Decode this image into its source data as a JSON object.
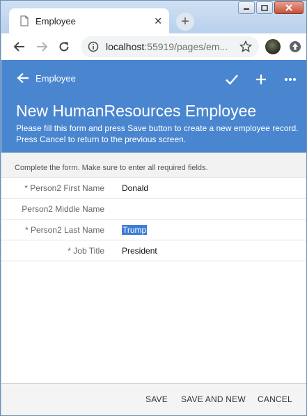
{
  "browser": {
    "tab_title": "Employee",
    "tab_close": "✕",
    "new_tab": "+",
    "url_host": "localhost",
    "url_rest": ":55919/pages/em..."
  },
  "header": {
    "back_label": "Employee",
    "title": "New HumanResources Employee",
    "subtitle": "Please fill this form and press Save button to create a new employee record. Press Cancel to return to the previous screen."
  },
  "form": {
    "instructions": "Complete the form. Make sure to enter all required fields.",
    "fields": [
      {
        "label": "* Person2 First Name",
        "value": "Donald"
      },
      {
        "label": "Person2 Middle Name",
        "value": ""
      },
      {
        "label": "* Person2 Last Name",
        "value": "Trump"
      },
      {
        "label": "* Job Title",
        "value": "President"
      }
    ]
  },
  "footer": {
    "save": "SAVE",
    "save_and_new": "SAVE AND NEW",
    "cancel": "CANCEL"
  },
  "colors": {
    "header_bg": "#4a86d0",
    "selection": "#3d7bd8"
  },
  "icons": [
    "minimize-icon",
    "maximize-icon",
    "close-icon",
    "back-arrow-icon",
    "forward-arrow-icon",
    "reload-icon",
    "info-icon",
    "star-icon",
    "checkmark-icon",
    "plus-icon",
    "more-icon"
  ]
}
